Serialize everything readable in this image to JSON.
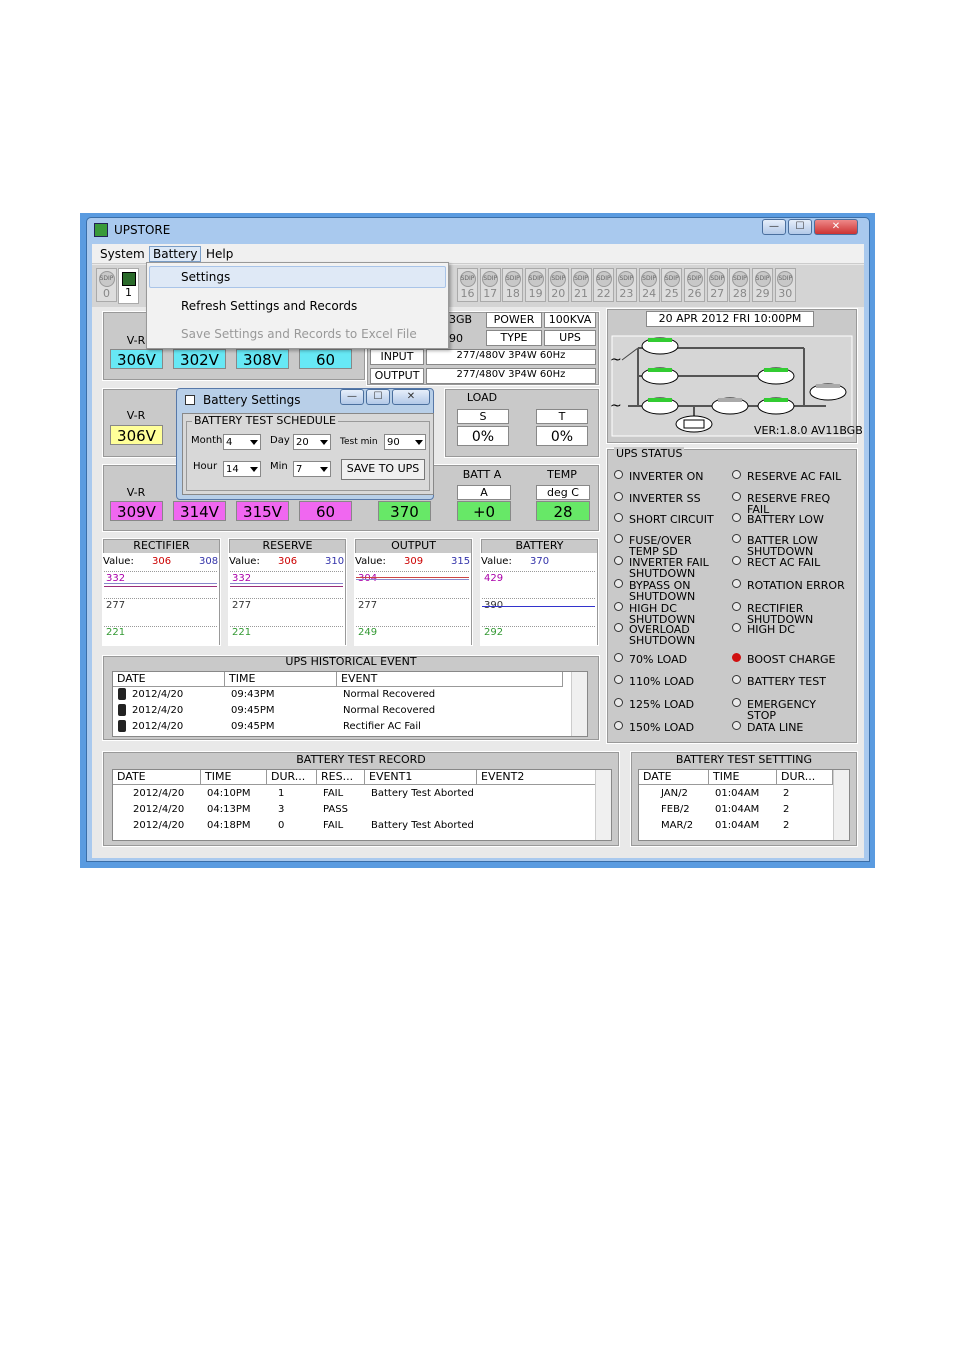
{
  "window": {
    "title": "UPSTORE",
    "min": "—",
    "max": "☐",
    "close": "✕"
  },
  "menubar": [
    "System",
    "Battery",
    "Help"
  ],
  "tabs": [
    "0",
    "1",
    "16",
    "17",
    "18",
    "19",
    "20",
    "21",
    "22",
    "23",
    "24",
    "25",
    "26",
    "27",
    "28",
    "29",
    "30"
  ],
  "tab_icon_text": "SDIP",
  "battery_menu": {
    "settings": "Settings",
    "refresh": "Refresh Settings and Records",
    "save": "Save Settings and Records to Excel File"
  },
  "info": {
    "partial_gb": "3GB",
    "partial_90": "90",
    "power_label": "POWER",
    "power_value": "100KVA",
    "type_label": "TYPE",
    "type_value": "UPS",
    "input_label": "INPUT",
    "input_value": "277/480V 3P4W 60Hz",
    "output_label": "OUTPUT",
    "output_value": "277/480V 3P4W 60Hz",
    "datetime": "20 APR 2012 FRI  10:00PM",
    "version": "VER:1.8.0 AV11BGB"
  },
  "row1": {
    "label": "V-R",
    "v1": "306V",
    "v2": "302V",
    "v3": "308V",
    "v4": "60"
  },
  "row2": {
    "label": "V-R",
    "v1": "306V",
    "load": "LOAD",
    "s_label": "S",
    "s_val": "0%",
    "t_label": "T",
    "t_val": "0%"
  },
  "row3": {
    "label": "V-R",
    "v1": "309V",
    "v2": "314V",
    "v3": "315V",
    "v4": "60",
    "v5": "370",
    "batt_label": "BATT A",
    "batt_sub": "A",
    "batt_val": "+0",
    "temp_label": "TEMP",
    "temp_sub": "deg C",
    "temp_val": "28"
  },
  "dialog": {
    "title": "Battery Settings",
    "group": "BATTERY TEST SCHEDULE",
    "month_label": "Month",
    "month": "4",
    "day_label": "Day",
    "day": "20",
    "testmin_label": "Test min",
    "testmin": "90",
    "hour_label": "Hour",
    "hour": "14",
    "min_label": "Min",
    "min": "7",
    "save_btn": "SAVE TO UPS"
  },
  "graphs": [
    {
      "title": "RECTIFIER",
      "value_label": "Value:",
      "v1": "306",
      "v2": "308",
      "top": "332",
      "mid": "277",
      "bot": "221"
    },
    {
      "title": "RESERVE",
      "value_label": "Value:",
      "v1": "306",
      "v2": "310",
      "top": "332",
      "mid": "277",
      "bot": "221"
    },
    {
      "title": "OUTPUT",
      "value_label": "Value:",
      "v1": "309",
      "v2": "315",
      "top": "304",
      "mid": "277",
      "bot": "249"
    },
    {
      "title": "BATTERY",
      "value_label": "Value:",
      "v1": "370",
      "v2": "",
      "top": "429",
      "mid": "390",
      "bot": "292"
    }
  ],
  "ups_status": {
    "title": "UPS STATUS",
    "left": [
      "INVERTER ON",
      "INVERTER SS",
      "SHORT CIRCUIT",
      "FUSE/OVER TEMP SD",
      "INVERTER FAIL SHUTDOWN",
      "BYPASS ON SHUTDOWN",
      "HIGH DC SHUTDOWN",
      "OVERLOAD SHUTDOWN",
      "70% LOAD",
      "110% LOAD",
      "125% LOAD",
      "150% LOAD"
    ],
    "right": [
      "RESERVE AC FAIL",
      "RESERVE FREQ FAIL",
      "BATTERY LOW",
      "BATTER LOW SHUTDOWN",
      "RECT AC FAIL",
      "ROTATION ERROR",
      "RECTIFIER SHUTDOWN",
      "HIGH DC",
      "BOOST CHARGE",
      "BATTERY TEST",
      "EMERGENCY STOP",
      "DATA LINE"
    ],
    "active_color": "#d01010"
  },
  "history": {
    "title": "UPS HISTORICAL  EVENT",
    "headers": [
      "DATE",
      "TIME",
      "EVENT"
    ],
    "rows": [
      [
        "2012/4/20",
        "09:43PM",
        "Normal Recovered"
      ],
      [
        "2012/4/20",
        "09:45PM",
        "Normal Recovered"
      ],
      [
        "2012/4/20",
        "09:45PM",
        "Rectifier AC Fail"
      ]
    ]
  },
  "test_record": {
    "title": "BATTERY TEST RECORD",
    "headers": [
      "DATE",
      "TIME",
      "DUR...",
      "RES...",
      "EVENT1",
      "EVENT2"
    ],
    "rows": [
      [
        "2012/4/20",
        "04:10PM",
        "1",
        "FAIL",
        "Battery Test Aborted",
        ""
      ],
      [
        "2012/4/20",
        "04:13PM",
        "3",
        "PASS",
        "",
        ""
      ],
      [
        "2012/4/20",
        "04:18PM",
        "0",
        "FAIL",
        "Battery Test Aborted",
        ""
      ]
    ]
  },
  "test_setting": {
    "title": "BATTERY TEST SETTTING",
    "headers": [
      "DATE",
      "TIME",
      "DUR..."
    ],
    "rows": [
      [
        "JAN/2",
        "01:04AM",
        "2"
      ],
      [
        "FEB/2",
        "01:04AM",
        "2"
      ],
      [
        "MAR/2",
        "01:04AM",
        "2"
      ]
    ]
  }
}
